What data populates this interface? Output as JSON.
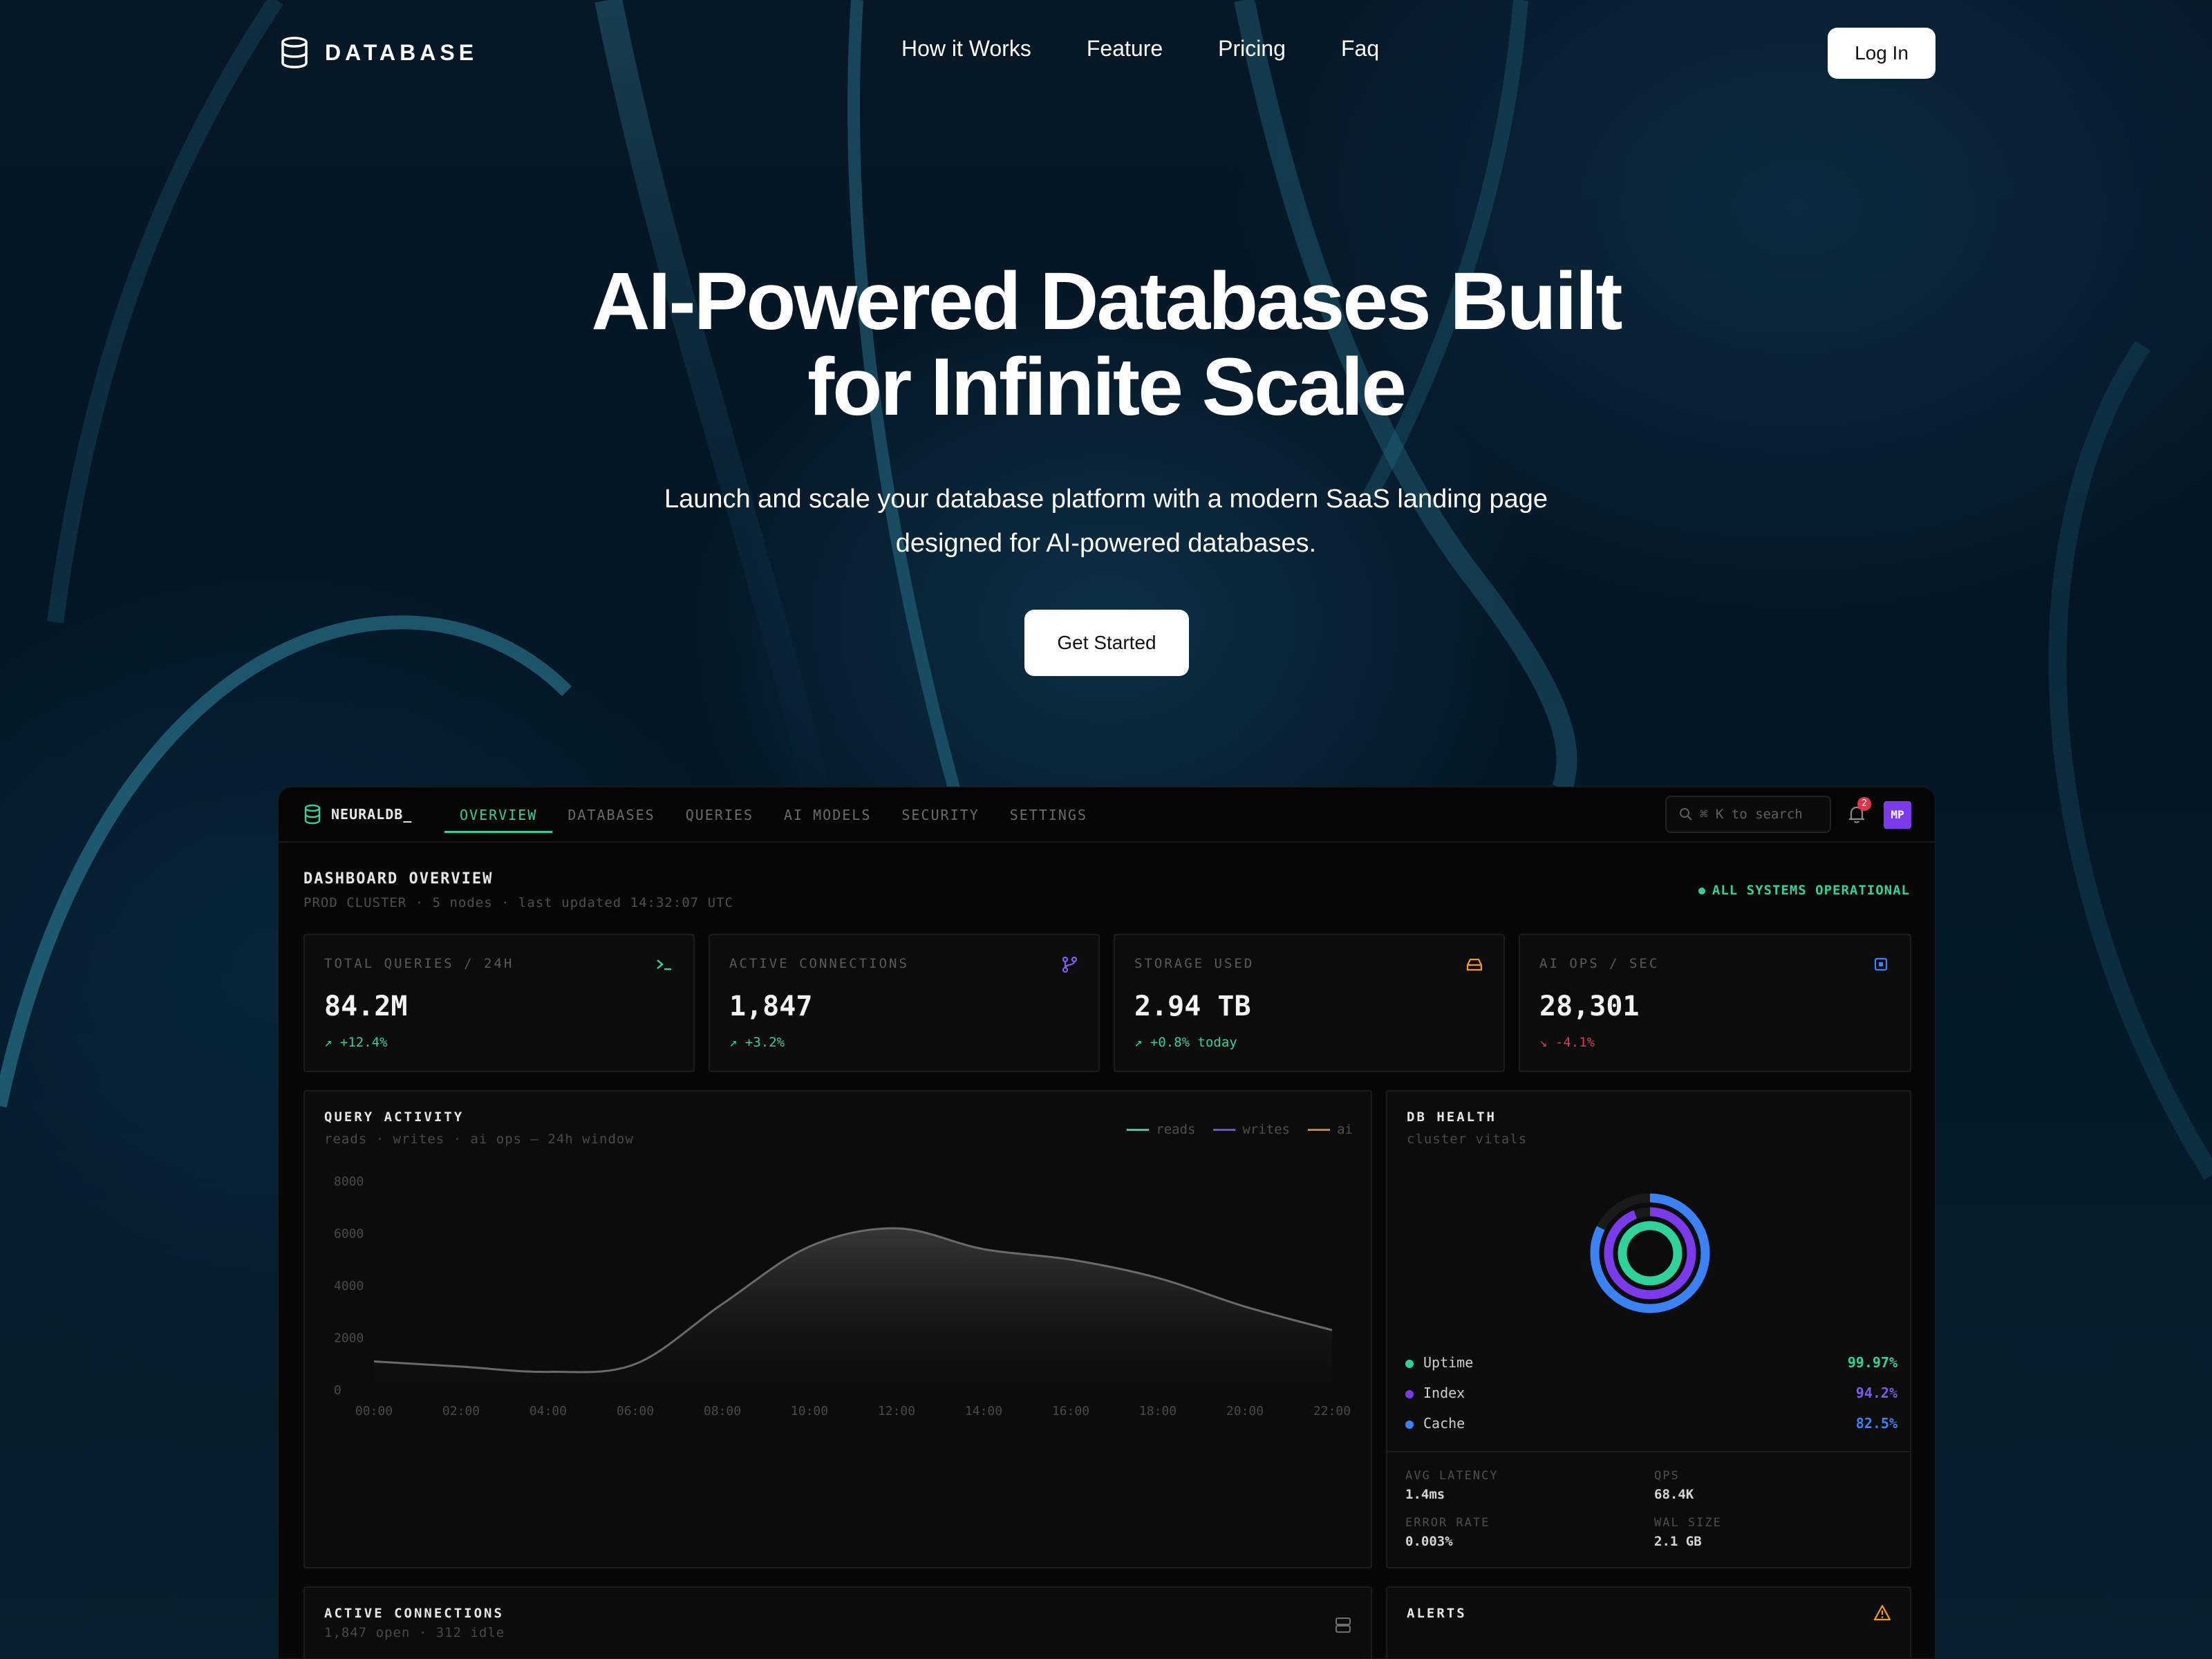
{
  "nav": {
    "logo_text": "DATABASE",
    "links": [
      "How it Works",
      "Feature",
      "Pricing",
      "Faq"
    ],
    "login_label": "Log In"
  },
  "hero": {
    "title_line1": "AI-Powered Databases Built",
    "title_line2": "for Infinite Scale",
    "subtitle_line1": "Launch and scale your database platform with a modern SaaS landing page",
    "subtitle_line2": "designed for AI-powered databases.",
    "cta_label": "Get Started"
  },
  "dashboard": {
    "brand": "NEURALDB_",
    "tabs": [
      "OVERVIEW",
      "DATABASES",
      "QUERIES",
      "AI MODELS",
      "SECURITY",
      "SETTINGS"
    ],
    "active_tab": "OVERVIEW",
    "search_placeholder": "⌘ K to search",
    "notification_count": "2",
    "avatar_initials": "MP",
    "title": "DASHBOARD OVERVIEW",
    "subtitle": "PROD CLUSTER · 5 nodes · last updated 14:32:07 UTC",
    "status": "ALL SYSTEMS OPERATIONAL",
    "stats": [
      {
        "label": "TOTAL QUERIES / 24H",
        "value": "84.2M",
        "delta": "↗ +12.4%",
        "trend": "up",
        "icon": "terminal-icon",
        "color": "#2fd39a"
      },
      {
        "label": "ACTIVE CONNECTIONS",
        "value": "1,847",
        "delta": "↗ +3.2%",
        "trend": "up",
        "icon": "branch-icon",
        "color": "#8b5cf6"
      },
      {
        "label": "STORAGE USED",
        "value": "2.94 TB",
        "delta": "↗ +0.8% today",
        "trend": "up",
        "icon": "drive-icon",
        "color": "#f59e0b"
      },
      {
        "label": "AI OPS / SEC",
        "value": "28,301",
        "delta": "↘ -4.1%",
        "trend": "down",
        "icon": "chip-icon",
        "color": "#3b82f6"
      }
    ],
    "query_activity": {
      "title": "QUERY ACTIVITY",
      "subtitle": "reads · writes · ai ops — 24h window",
      "legend": [
        {
          "name": "reads",
          "color": "#2fd39a"
        },
        {
          "name": "writes",
          "color": "#6d4ee0"
        },
        {
          "name": "ai",
          "color": "#c8862a"
        }
      ]
    },
    "db_health": {
      "title": "DB HEALTH",
      "subtitle": "cluster vitals",
      "items": [
        {
          "label": "Uptime",
          "value": "99.97%",
          "color": "#2fd39a",
          "fraction": 0.9997
        },
        {
          "label": "Index",
          "value": "94.2%",
          "color": "#7c3aed",
          "fraction": 0.942
        },
        {
          "label": "Cache",
          "value": "82.5%",
          "color": "#3b82f6",
          "fraction": 0.825
        }
      ],
      "metrics": [
        {
          "label": "AVG LATENCY",
          "value": "1.4ms"
        },
        {
          "label": "QPS",
          "value": "68.4K"
        },
        {
          "label": "ERROR RATE",
          "value": "0.003%"
        },
        {
          "label": "WAL SIZE",
          "value": "2.1 GB"
        }
      ]
    },
    "active_connections": {
      "title": "ACTIVE CONNECTIONS",
      "subtitle": "1,847 open · 312 idle"
    },
    "alerts": {
      "title": "ALERTS"
    }
  },
  "chart_data": {
    "type": "area",
    "x": [
      "00:00",
      "02:00",
      "04:00",
      "06:00",
      "08:00",
      "10:00",
      "12:00",
      "14:00",
      "16:00",
      "18:00",
      "20:00",
      "22:00"
    ],
    "y_ticks": [
      "8000",
      "6000",
      "4000",
      "2000",
      "0"
    ],
    "ylim": [
      0,
      8000
    ],
    "series": [
      {
        "name": "reads",
        "values": [
          1100,
          900,
          700,
          1000,
          3300,
          5500,
          6200,
          5400,
          5000,
          4300,
          3200,
          2300
        ]
      }
    ],
    "grid": false,
    "legend": "top-right"
  }
}
